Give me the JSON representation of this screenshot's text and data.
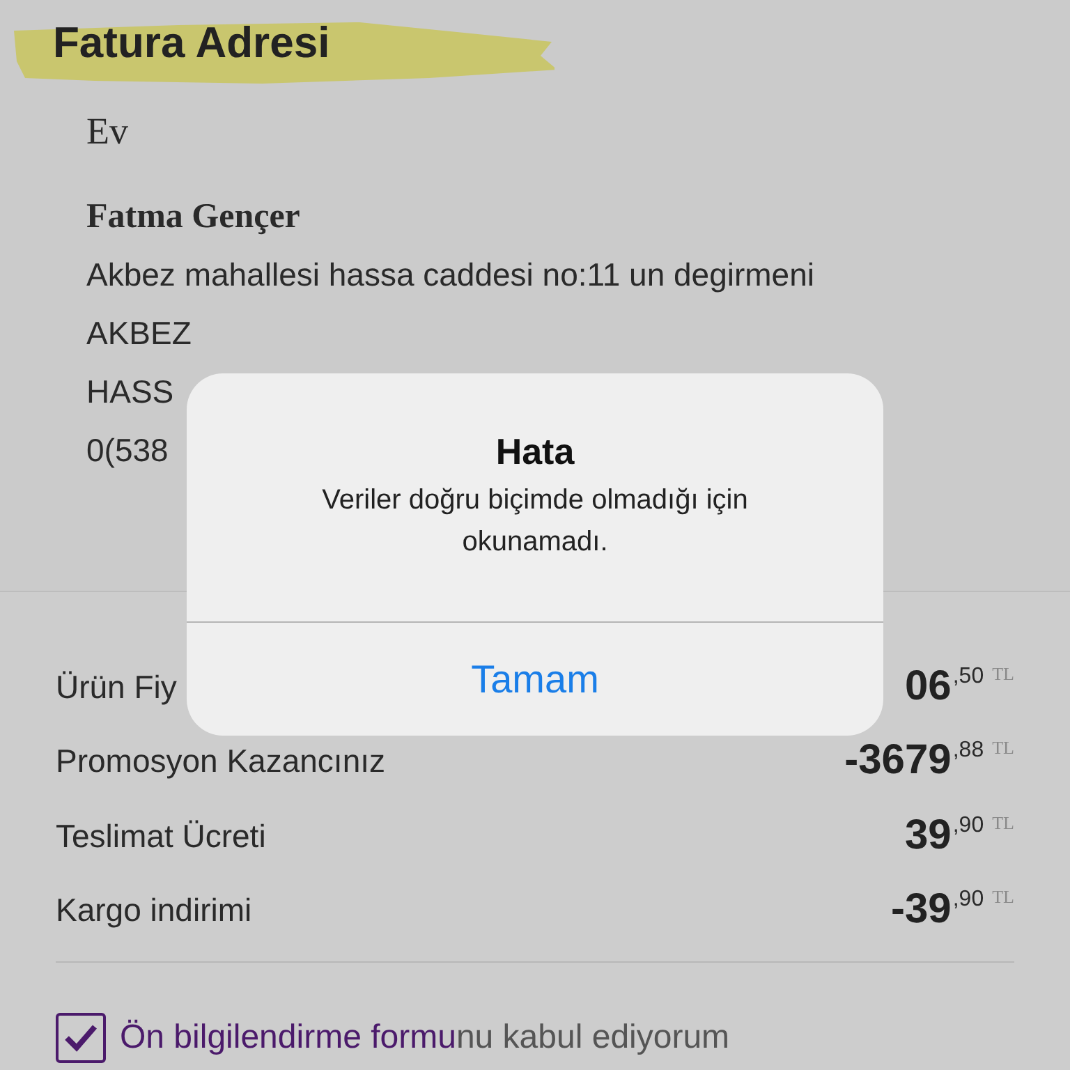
{
  "section_title": "Fatura Adresi",
  "address": {
    "label": "Ev",
    "name": "Fatma Gençer",
    "lines": [
      "Akbez mahallesi hassa caddesi no:11 un degirmeni",
      "AKBEZ",
      "HASS",
      "0(538"
    ]
  },
  "summary": [
    {
      "label": "Ürün Fiy",
      "amount": "06",
      "decimals": ",50",
      "currency": "TL"
    },
    {
      "label": "Promosyon Kazancınız",
      "amount": "-3679",
      "decimals": ",88",
      "currency": "TL"
    },
    {
      "label": "Teslimat Ücreti",
      "amount": "39",
      "decimals": ",90",
      "currency": "TL"
    },
    {
      "label": "Kargo indirimi",
      "amount": "-39",
      "decimals": ",90",
      "currency": "TL"
    }
  ],
  "agreement": {
    "checked": true,
    "link": "Ön bilgilendirme formu",
    "text": "nu kabul ediyorum"
  },
  "alert": {
    "title": "Hata",
    "message": "Veriler doğru biçimde olmadığı için okunamadı.",
    "button": "Tamam"
  }
}
